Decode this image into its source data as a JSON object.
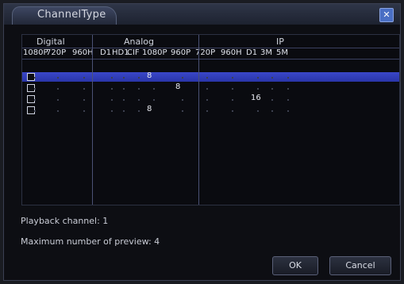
{
  "dialog": {
    "title": "ChannelType"
  },
  "groups": {
    "digital": "Digital",
    "analog": "Analog",
    "ip": "IP"
  },
  "columns": [
    "1080P",
    "720P",
    "960H",
    "D1",
    "HD1",
    "CIF",
    "1080P",
    "960P",
    "720P",
    "960H",
    "D1",
    "3M",
    "5M"
  ],
  "rows": [
    {
      "selected": true,
      "values": [
        "",
        "",
        "",
        "",
        "",
        "",
        "8",
        "",
        "",
        "",
        "",
        "",
        ""
      ]
    },
    {
      "selected": false,
      "values": [
        "",
        "",
        "",
        "",
        "",
        "",
        "",
        "8",
        "",
        "",
        "",
        "",
        ""
      ]
    },
    {
      "selected": false,
      "values": [
        "",
        "",
        "",
        "",
        "",
        "",
        "",
        "",
        "",
        "",
        "16",
        "",
        ""
      ]
    },
    {
      "selected": false,
      "values": [
        "",
        "",
        "",
        "",
        "",
        "",
        "8",
        "",
        "",
        "",
        "",
        "",
        ""
      ]
    }
  ],
  "info": {
    "playback": "Playback channel: 1",
    "preview": "Maximum number of preview: 4"
  },
  "buttons": {
    "ok": "OK",
    "cancel": "Cancel"
  }
}
